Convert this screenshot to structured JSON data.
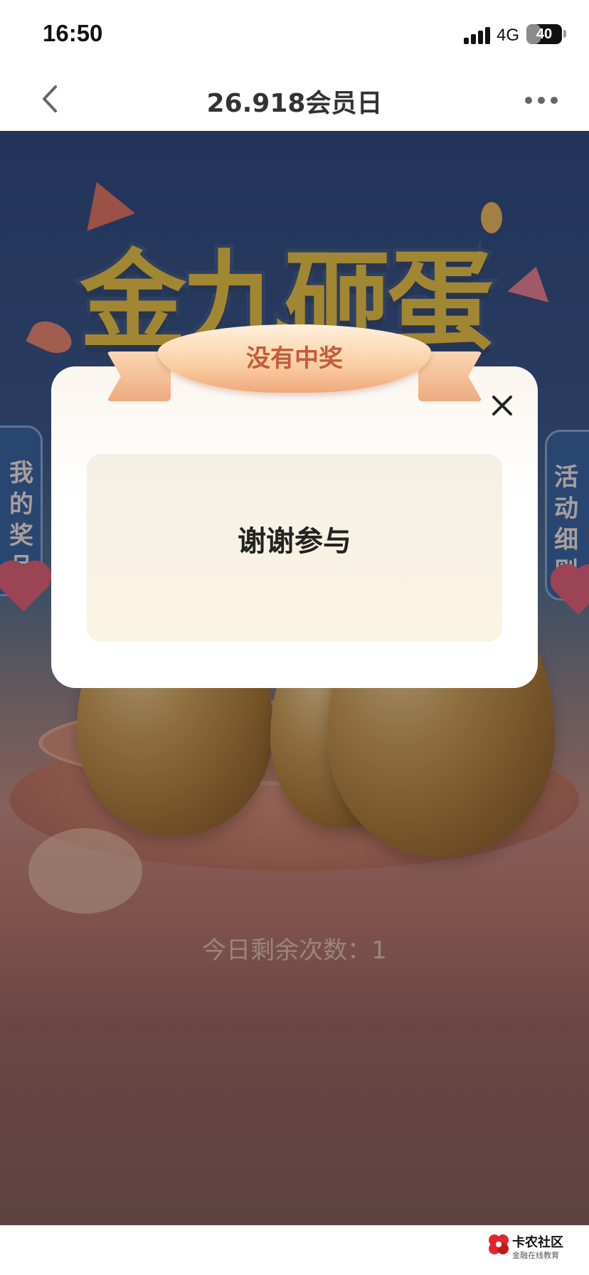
{
  "status_bar": {
    "time": "16:50",
    "network": "4G",
    "battery": "40",
    "battery_level": 0.4
  },
  "nav": {
    "title": "26.918会员日"
  },
  "game": {
    "banner_title": "金九砸蛋",
    "left_tab": "我的奖品",
    "right_tab": "活动细则",
    "remaining": "今日剩余次数：1"
  },
  "modal": {
    "ribbon_title": "没有中奖",
    "result": "谢谢参与"
  },
  "footer": {
    "brand": "卡农社区",
    "tagline": "金融在线教育"
  }
}
